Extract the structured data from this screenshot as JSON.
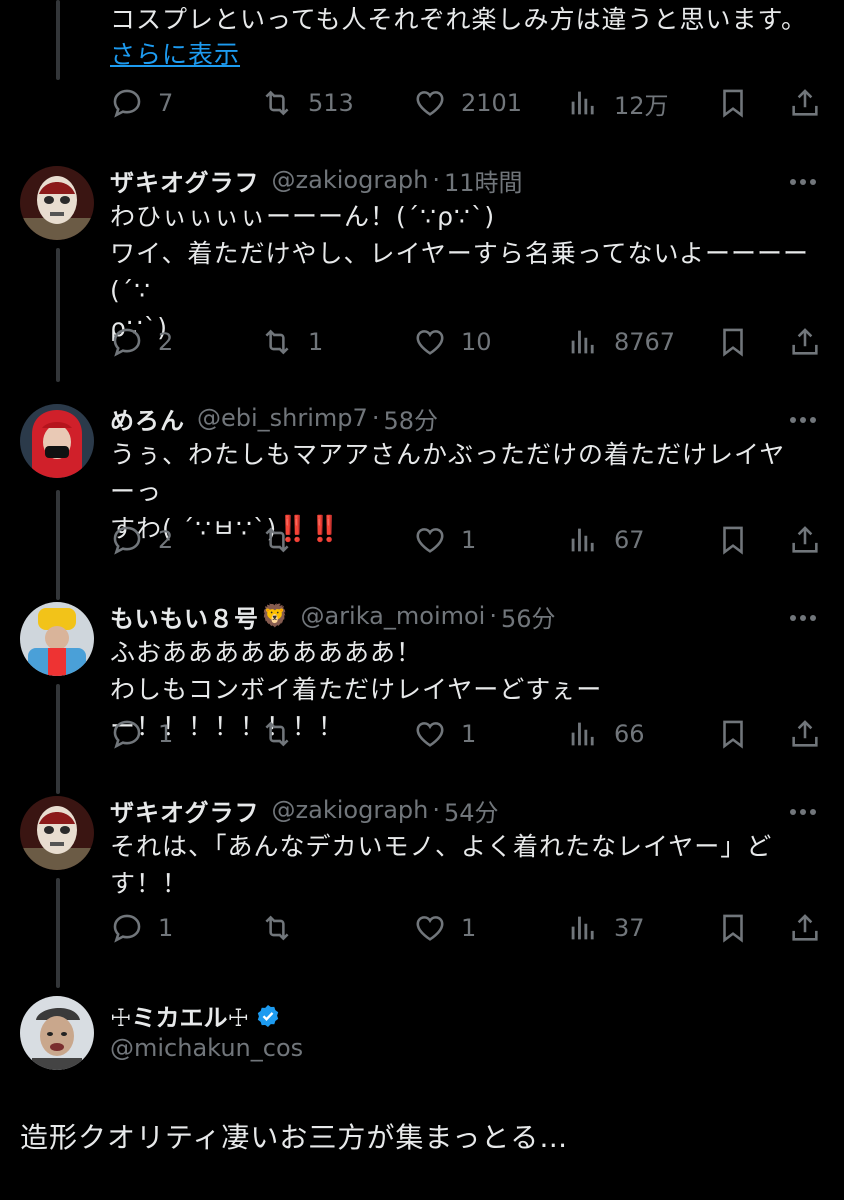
{
  "top_post": {
    "text": "コスプレといっても人それぞれ楽しみ方は違うと思います。",
    "show_more": "さらに表示",
    "replies": "7",
    "reposts": "513",
    "likes": "2101",
    "views": "12万"
  },
  "replies": [
    {
      "name": "ザキオグラフ",
      "emoji": "",
      "handle": "@zakiograph",
      "time": "11時間",
      "lines": [
        "わひぃぃぃぃーーーん！(´∵ρ∵`)",
        "ワイ、着ただけやし、レイヤーすら名乗ってないよーーーー(´∵",
        "ρ∵`)"
      ],
      "bang": "",
      "replies": "2",
      "reposts": "1",
      "likes": "10",
      "views": "8767"
    },
    {
      "name": "めろん",
      "emoji": "",
      "handle": "@ebi_shrimp7",
      "time": "58分",
      "lines": [
        "うぅ、わたしもマアアさんかぶっただけの着ただけレイヤーっ",
        "すわ( ´∵ㅂ∵`)"
      ],
      "bang": "‼️‼️",
      "replies": "2",
      "reposts": "",
      "likes": "1",
      "views": "67"
    },
    {
      "name": "もいもい８号",
      "emoji": "🦁",
      "handle": "@arika_moimoi",
      "time": "56分",
      "lines": [
        "ふおあああああああああ！",
        "わしもコンボイ着ただけレイヤーどすぇーー！！！！！！！！"
      ],
      "bang": "",
      "replies": "1",
      "reposts": "",
      "likes": "1",
      "views": "66"
    },
    {
      "name": "ザキオグラフ",
      "emoji": "",
      "handle": "@zakiograph",
      "time": "54分",
      "lines": [
        "それは、「あんなデカいモノ、よく着れたなレイヤー」ど",
        "す！！"
      ],
      "bang": "",
      "replies": "1",
      "reposts": "",
      "likes": "1",
      "views": "37"
    }
  ],
  "main_post": {
    "name": "☩ミカエル☩",
    "handle": "@michakun_cos",
    "text": "造形クオリティ凄いお三方が集まっとる…"
  },
  "colors": {
    "background": "#000000",
    "text": "#e7e9ea",
    "muted": "#71767b",
    "link": "#1d9bf0",
    "verified": "#1d9bf0"
  }
}
